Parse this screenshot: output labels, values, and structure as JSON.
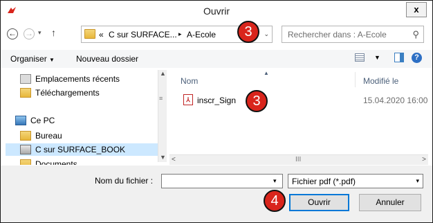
{
  "window": {
    "title": "Ouvrir",
    "close_label": "x"
  },
  "navigation": {
    "back_label": "←",
    "forward_label": "→",
    "dropdown_label": "▾",
    "up_label": "↑"
  },
  "address": {
    "chevrons": "«",
    "segment1": "C sur SURFACE...",
    "separator": "▸",
    "segment2": "A-Ecole",
    "dropdown_label": "⌄"
  },
  "search": {
    "placeholder": "Rechercher dans : A-Ecole",
    "icon": "search-icon"
  },
  "toolbar": {
    "organise_label": "Organiser",
    "organise_arrow": "▼",
    "new_folder_label": "Nouveau dossier",
    "views_arrow": "▼",
    "help_label": "?"
  },
  "sidebar": {
    "items": [
      {
        "label": "Emplacements récents",
        "icon": "recent-places-icon"
      },
      {
        "label": "Téléchargements",
        "icon": "downloads-icon"
      },
      {
        "label": "Ce PC",
        "icon": "pc-icon"
      },
      {
        "label": "Bureau",
        "icon": "folder-icon"
      },
      {
        "label": "C sur SURFACE_BOOK",
        "icon": "drive-icon",
        "selected": true
      },
      {
        "label": "Documents",
        "icon": "folder-icon"
      }
    ]
  },
  "file_list": {
    "columns": {
      "name": "Nom",
      "modified": "Modifié le"
    },
    "files": [
      {
        "name": "inscr_Sign",
        "modified": "15.04.2020 16:00",
        "icon": "pdf-icon"
      }
    ]
  },
  "scrollbars": {
    "up": "▲",
    "down": "▼",
    "grip": "≡",
    "left": "<",
    "right": ">",
    "hgrip": "III"
  },
  "bottom": {
    "filename_label": "Nom du fichier :",
    "filename_value": "",
    "filetype_value": "Fichier pdf (*.pdf)",
    "dropdown_label": "▾",
    "open_label": "Ouvrir",
    "cancel_label": "Annuler"
  },
  "callouts": {
    "address": "3",
    "file": "3",
    "open": "4"
  },
  "colors": {
    "callout": "#d9251c",
    "selection": "#cce8ff",
    "accent": "#0078d7"
  }
}
